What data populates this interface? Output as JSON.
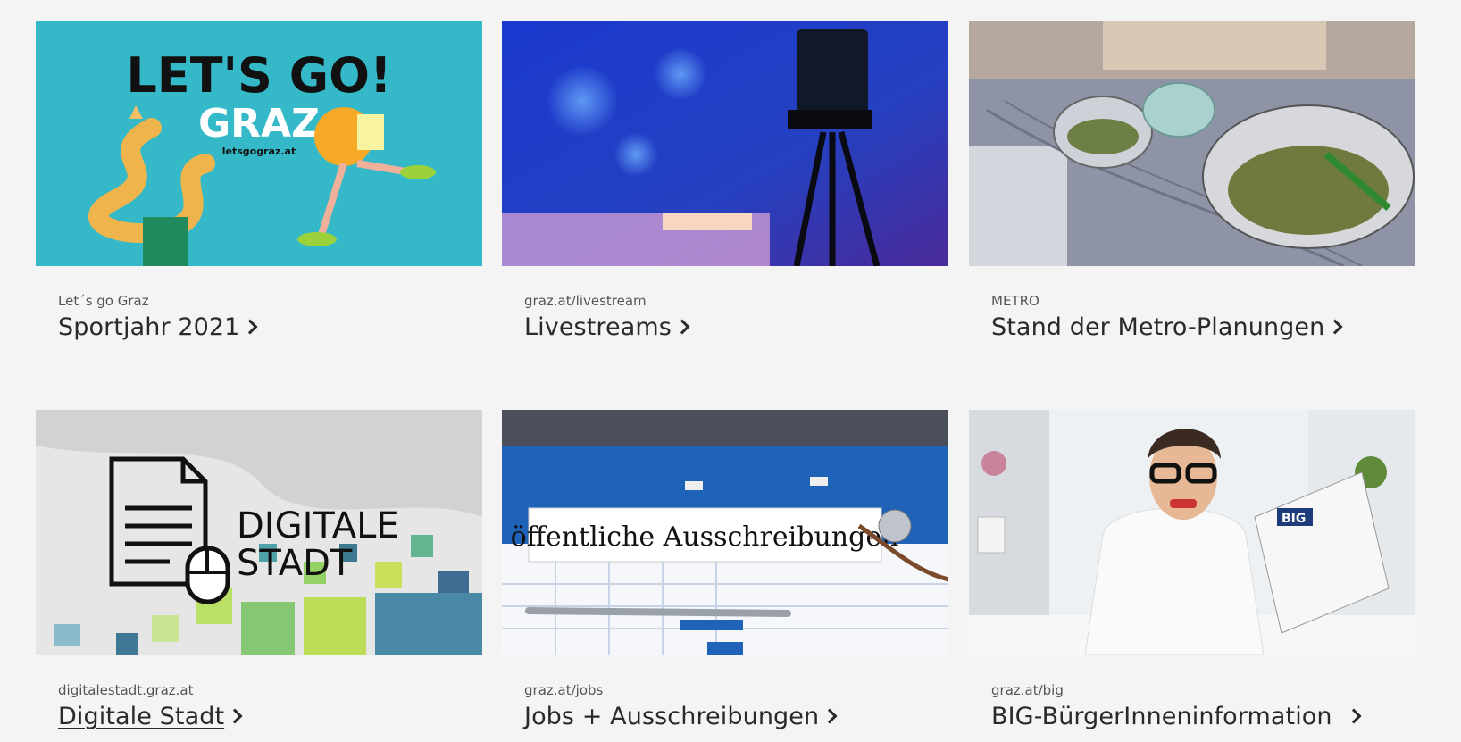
{
  "cards": [
    {
      "kicker": "Let´s go Graz",
      "title": "Sportjahr 2021",
      "image": {
        "headline": "LET'S GO!",
        "word": "GRAZ",
        "url": "letsgograz.at"
      }
    },
    {
      "kicker": "graz.at/livestream",
      "title": "Livestreams"
    },
    {
      "kicker": "METRO",
      "title": "Stand der Metro-Planungen"
    },
    {
      "kicker": "digitalestadt.graz.at",
      "title": "Digitale Stadt",
      "image": {
        "line1": "DIGITALE",
        "line2": "STADT"
      }
    },
    {
      "kicker": "graz.at/jobs",
      "title": "Jobs + Ausschreibungen",
      "image": {
        "label": "öffentliche Ausschreibungen"
      }
    },
    {
      "kicker": "graz.at/big",
      "title": "BIG-BürgerInneninformation",
      "image": {
        "paper": "BIG"
      }
    }
  ],
  "icons": {
    "chevron": "chevron-right-icon"
  },
  "colors": {
    "background": "#f4f4f4",
    "teal": "#3bb8c6",
    "blue": "#1f4fc9"
  }
}
